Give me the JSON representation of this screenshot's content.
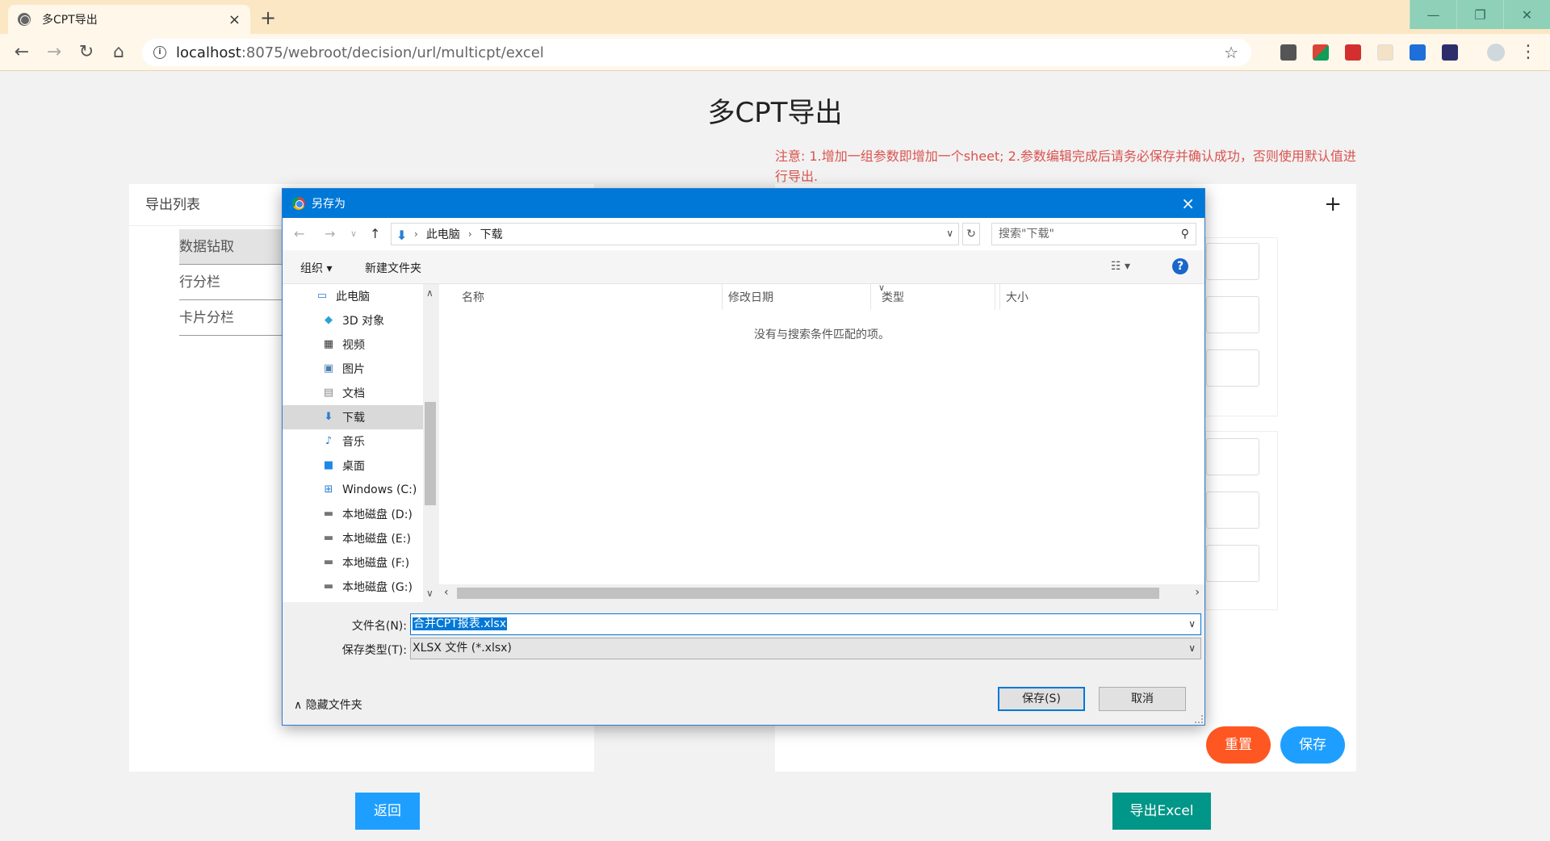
{
  "browser": {
    "tab_title": "多CPT导出",
    "tab_close": "×",
    "new_tab": "+",
    "url_host": "localhost",
    "url_path": ":8075/webroot/decision/url/multicpt/excel",
    "window_buttons": [
      "—",
      "❐",
      "✕"
    ]
  },
  "page": {
    "title": "多CPT导出",
    "notice": "注意: 1.增加一组参数即增加一个sheet; 2.参数编辑完成后请务必保存并确认成功，否则使用默认值进行导出.",
    "export_list_label": "导出列表",
    "list_items": [
      "数据钻取",
      "行分栏",
      "卡片分栏"
    ],
    "add": "+",
    "reset_button": "重置",
    "save_button": "保存",
    "back_button": "返回",
    "export_button": "导出Excel",
    "colors": {
      "reset": "#ff5722",
      "save": "#1e9fff",
      "back": "#1e9fff",
      "export": "#009688"
    }
  },
  "dialog": {
    "title": "另存为",
    "close": "×",
    "breadcrumb": [
      "此电脑",
      "下载"
    ],
    "search_placeholder": "搜索\"下载\"",
    "organize": "组织 ▾",
    "new_folder": "新建文件夹",
    "view_toggle": "☷ ▾",
    "help": "?",
    "nav_items": [
      {
        "label": "此电脑",
        "icon": "computer-icon"
      },
      {
        "label": "3D 对象",
        "icon": "3d-objects-icon"
      },
      {
        "label": "视频",
        "icon": "videos-icon"
      },
      {
        "label": "图片",
        "icon": "pictures-icon"
      },
      {
        "label": "文档",
        "icon": "documents-icon"
      },
      {
        "label": "下载",
        "icon": "downloads-icon"
      },
      {
        "label": "音乐",
        "icon": "music-icon"
      },
      {
        "label": "桌面",
        "icon": "desktop-icon"
      },
      {
        "label": "Windows (C:)",
        "icon": "windows-drive-icon"
      },
      {
        "label": "本地磁盘 (D:)",
        "icon": "drive-icon"
      },
      {
        "label": "本地磁盘 (E:)",
        "icon": "drive-icon"
      },
      {
        "label": "本地磁盘 (F:)",
        "icon": "drive-icon"
      },
      {
        "label": "本地磁盘 (G:)",
        "icon": "drive-icon"
      }
    ],
    "columns": [
      "名称",
      "修改日期",
      "类型",
      "大小"
    ],
    "empty_message": "没有与搜索条件匹配的项。",
    "filename_label": "文件名(N):",
    "filename_value": "合并CPT报表.xlsx",
    "filetype_label": "保存类型(T):",
    "filetype_value": "XLSX 文件 (*.xlsx)",
    "hide_folders": "隐藏文件夹",
    "save": "保存(S)",
    "cancel": "取消"
  }
}
